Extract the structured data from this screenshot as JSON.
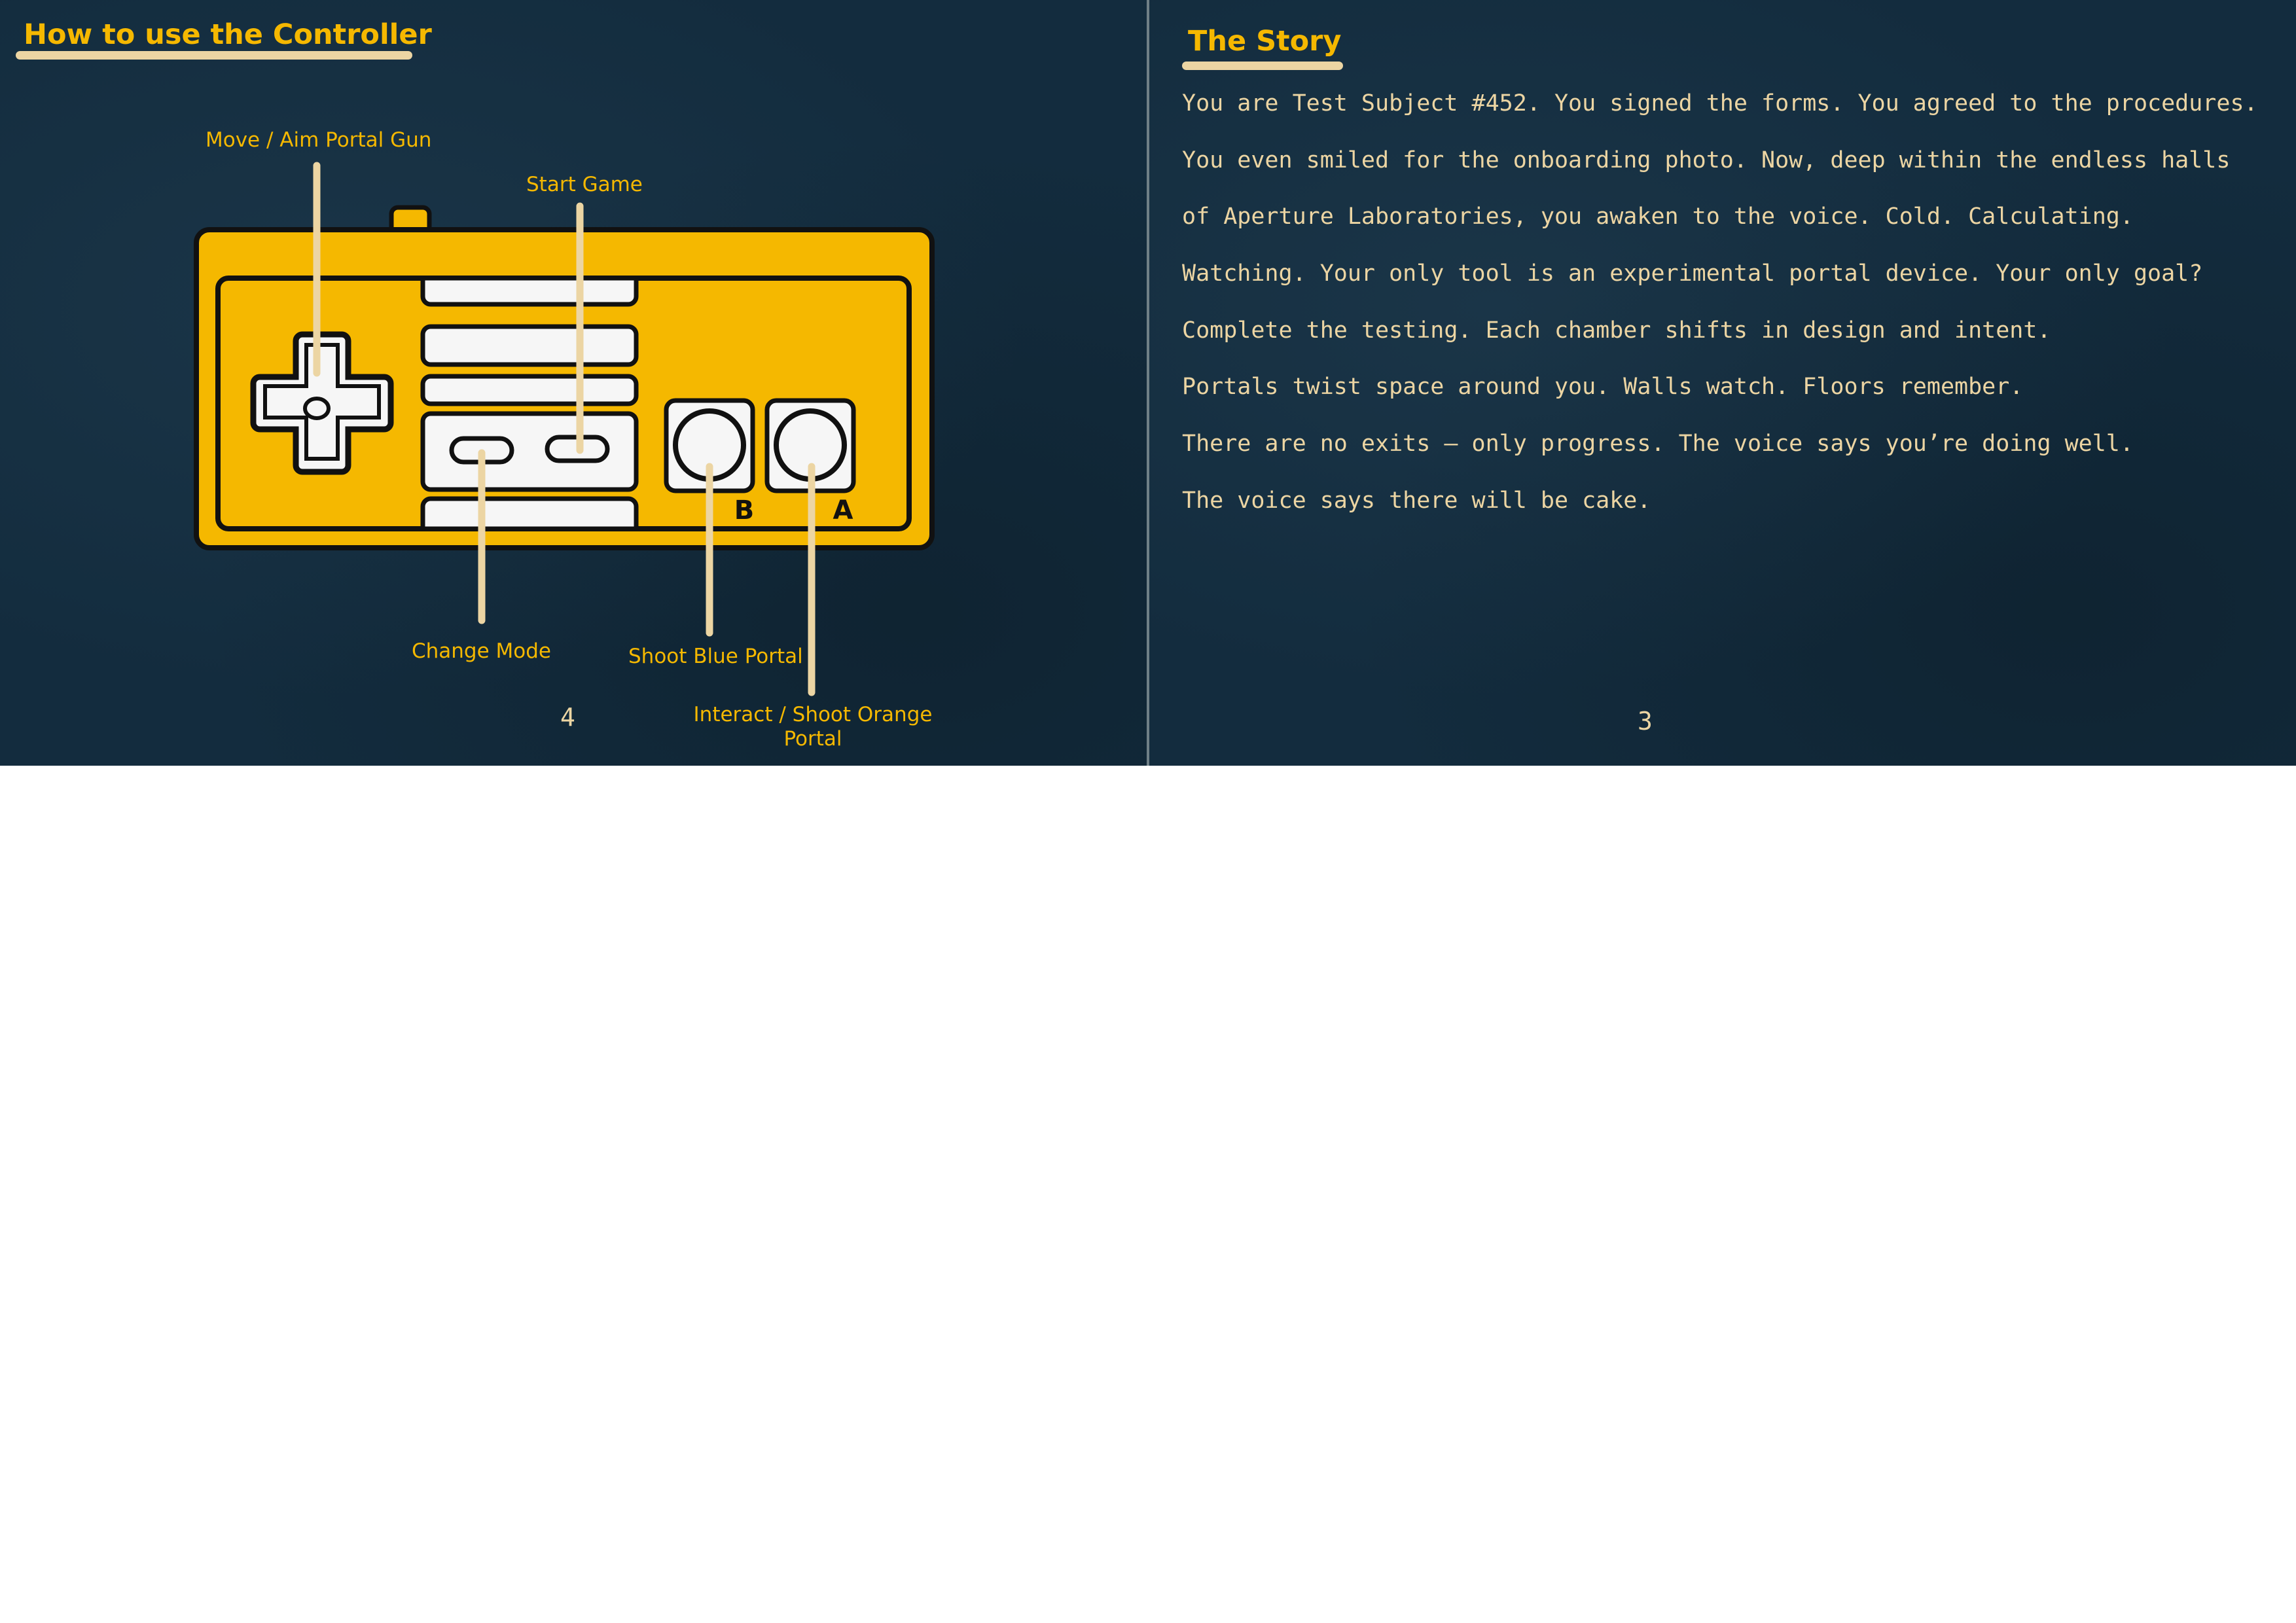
{
  "left_page": {
    "heading": "How to use the Controller",
    "callouts": {
      "move_aim": "Move / Aim Portal Gun",
      "start_game": "Start Game",
      "change_mode": "Change Mode",
      "shoot_blue": "Shoot Blue Portal",
      "interact_orange": "Interact / Shoot Orange Portal"
    },
    "button_labels": {
      "b": "B",
      "a": "A"
    },
    "page_number": "4"
  },
  "right_page": {
    "heading": "The Story",
    "story_lines": [
      "You are Test Subject #452. You signed the forms. You agreed to the procedures.",
      "You even smiled for the onboarding photo. Now, deep within the endless halls",
      "of Aperture Laboratories, you awaken to the voice. Cold. Calculating.",
      "Watching. Your only tool is an experimental portal device. Your only goal?",
      "Complete the testing. Each chamber shifts in design and intent.",
      "Portals twist space around you. Walls watch. Floors remember.",
      "There are no exits — only progress. The voice says you’re doing well.",
      "The voice says there will be cake."
    ],
    "page_number": "3"
  },
  "colors": {
    "page_background": "#132c3e",
    "heading_yellow": "#f5b800",
    "cream": "#ecd5a3",
    "controller_body": "#f5b800",
    "button_white": "#f6f6f6",
    "outline": "#111111"
  },
  "icons": [
    "gamepad-controller-icon",
    "dpad-icon"
  ]
}
